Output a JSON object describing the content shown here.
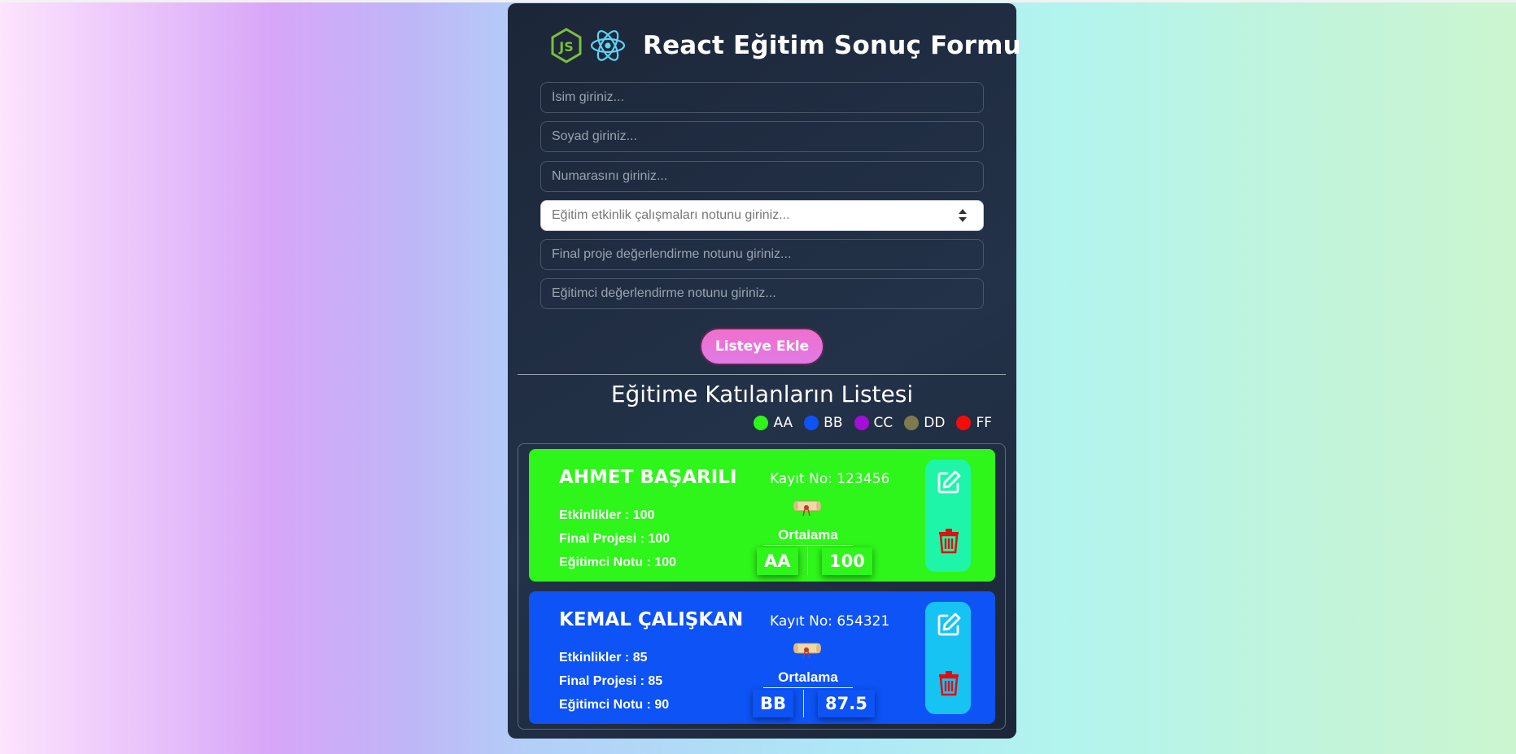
{
  "header": {
    "title": "React Eğitim Sonuç Formu",
    "logos": [
      "nodejs-icon",
      "react-icon"
    ]
  },
  "form": {
    "first_name_placeholder": "İsim giriniz...",
    "last_name_placeholder": "Soyad giriniz...",
    "number_placeholder": "Numarasını giriniz...",
    "activities_placeholder": "Eğitim etkinlik çalışmaları notunu giriniz...",
    "final_project_placeholder": "Final proje değerlendirme notunu giriniz...",
    "instructor_placeholder": "Eğitimci değerlendirme notunu giriniz...",
    "submit_label": "Listeye Ekle"
  },
  "list": {
    "title": "Eğitime Katılanların Listesi",
    "legend": [
      {
        "label": "AA",
        "color": "#2ef51a"
      },
      {
        "label": "BB",
        "color": "#0d53f5"
      },
      {
        "label": "CC",
        "color": "#a20fd6"
      },
      {
        "label": "DD",
        "color": "#7f7a4d"
      },
      {
        "label": "FF",
        "color": "#f70a0a"
      }
    ],
    "students": [
      {
        "name": "AHMET BAŞARILI",
        "kayit": "Kayıt No: 123456",
        "activities": "Etkinlikler : 100",
        "final": "Final Projesi : 100",
        "instructor": "Eğitimci Notu : 100",
        "avg_label": "Ortalama",
        "grade": "AA",
        "average": "100",
        "card_color": "#2ef51a",
        "action_color": "#1ef5a8"
      },
      {
        "name": "KEMAL ÇALIŞKAN",
        "kayit": "Kayıt No: 654321",
        "activities": "Etkinlikler : 85",
        "final": "Final Projesi : 85",
        "instructor": "Eğitimci Notu : 90",
        "avg_label": "Ortalama",
        "grade": "BB",
        "average": "87.5",
        "card_color": "#0d53f5",
        "action_color": "#17c3f2"
      }
    ]
  },
  "colors": {
    "panel_bg": "#1f2b40",
    "button_pink": "#ea74d8",
    "icon_red": "#e10f0f"
  }
}
